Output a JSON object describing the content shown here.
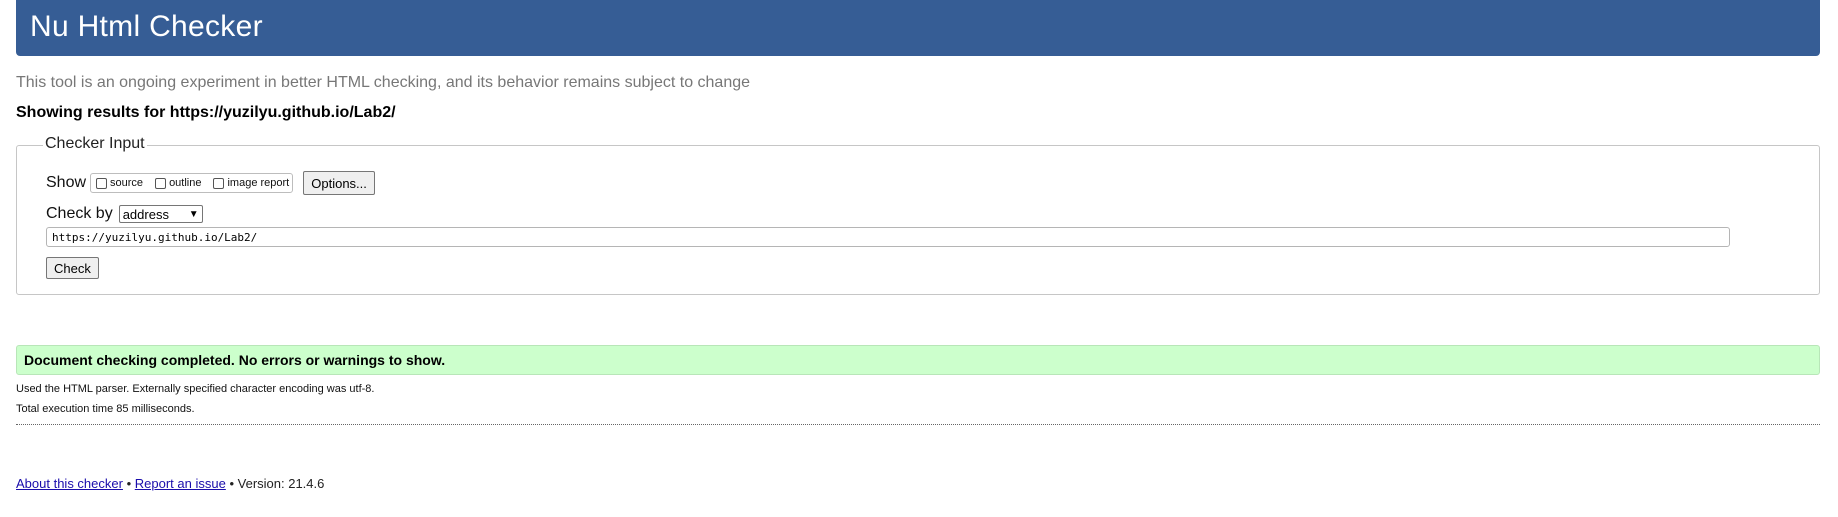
{
  "header": {
    "title": "Nu Html Checker"
  },
  "tagline": "This tool is an ongoing experiment in better HTML checking, and its behavior remains subject to change",
  "results_for": "Showing results for https://yuzilyu.github.io/Lab2/",
  "checker_input": {
    "legend": "Checker Input",
    "show_label": "Show",
    "show_options": [
      {
        "label": "source",
        "checked": false
      },
      {
        "label": "outline",
        "checked": false
      },
      {
        "label": "image report",
        "checked": false
      }
    ],
    "options_button": "Options...",
    "check_by_label": "Check by",
    "check_by_selected": "address",
    "url_value": "https://yuzilyu.github.io/Lab2/",
    "check_button": "Check"
  },
  "result": {
    "message": "Document checking completed. No errors or warnings to show.",
    "parser_info": "Used the HTML parser. Externally specified character encoding was utf-8.",
    "execution_time": "Total execution time 85 milliseconds."
  },
  "footer": {
    "about_link": "About this checker",
    "separator": "•",
    "report_link": "Report an issue",
    "version": "Version: 21.4.6"
  },
  "colors": {
    "header_bg": "#365d95",
    "success_bg": "#ccffcc",
    "link": "#1a0dab"
  }
}
